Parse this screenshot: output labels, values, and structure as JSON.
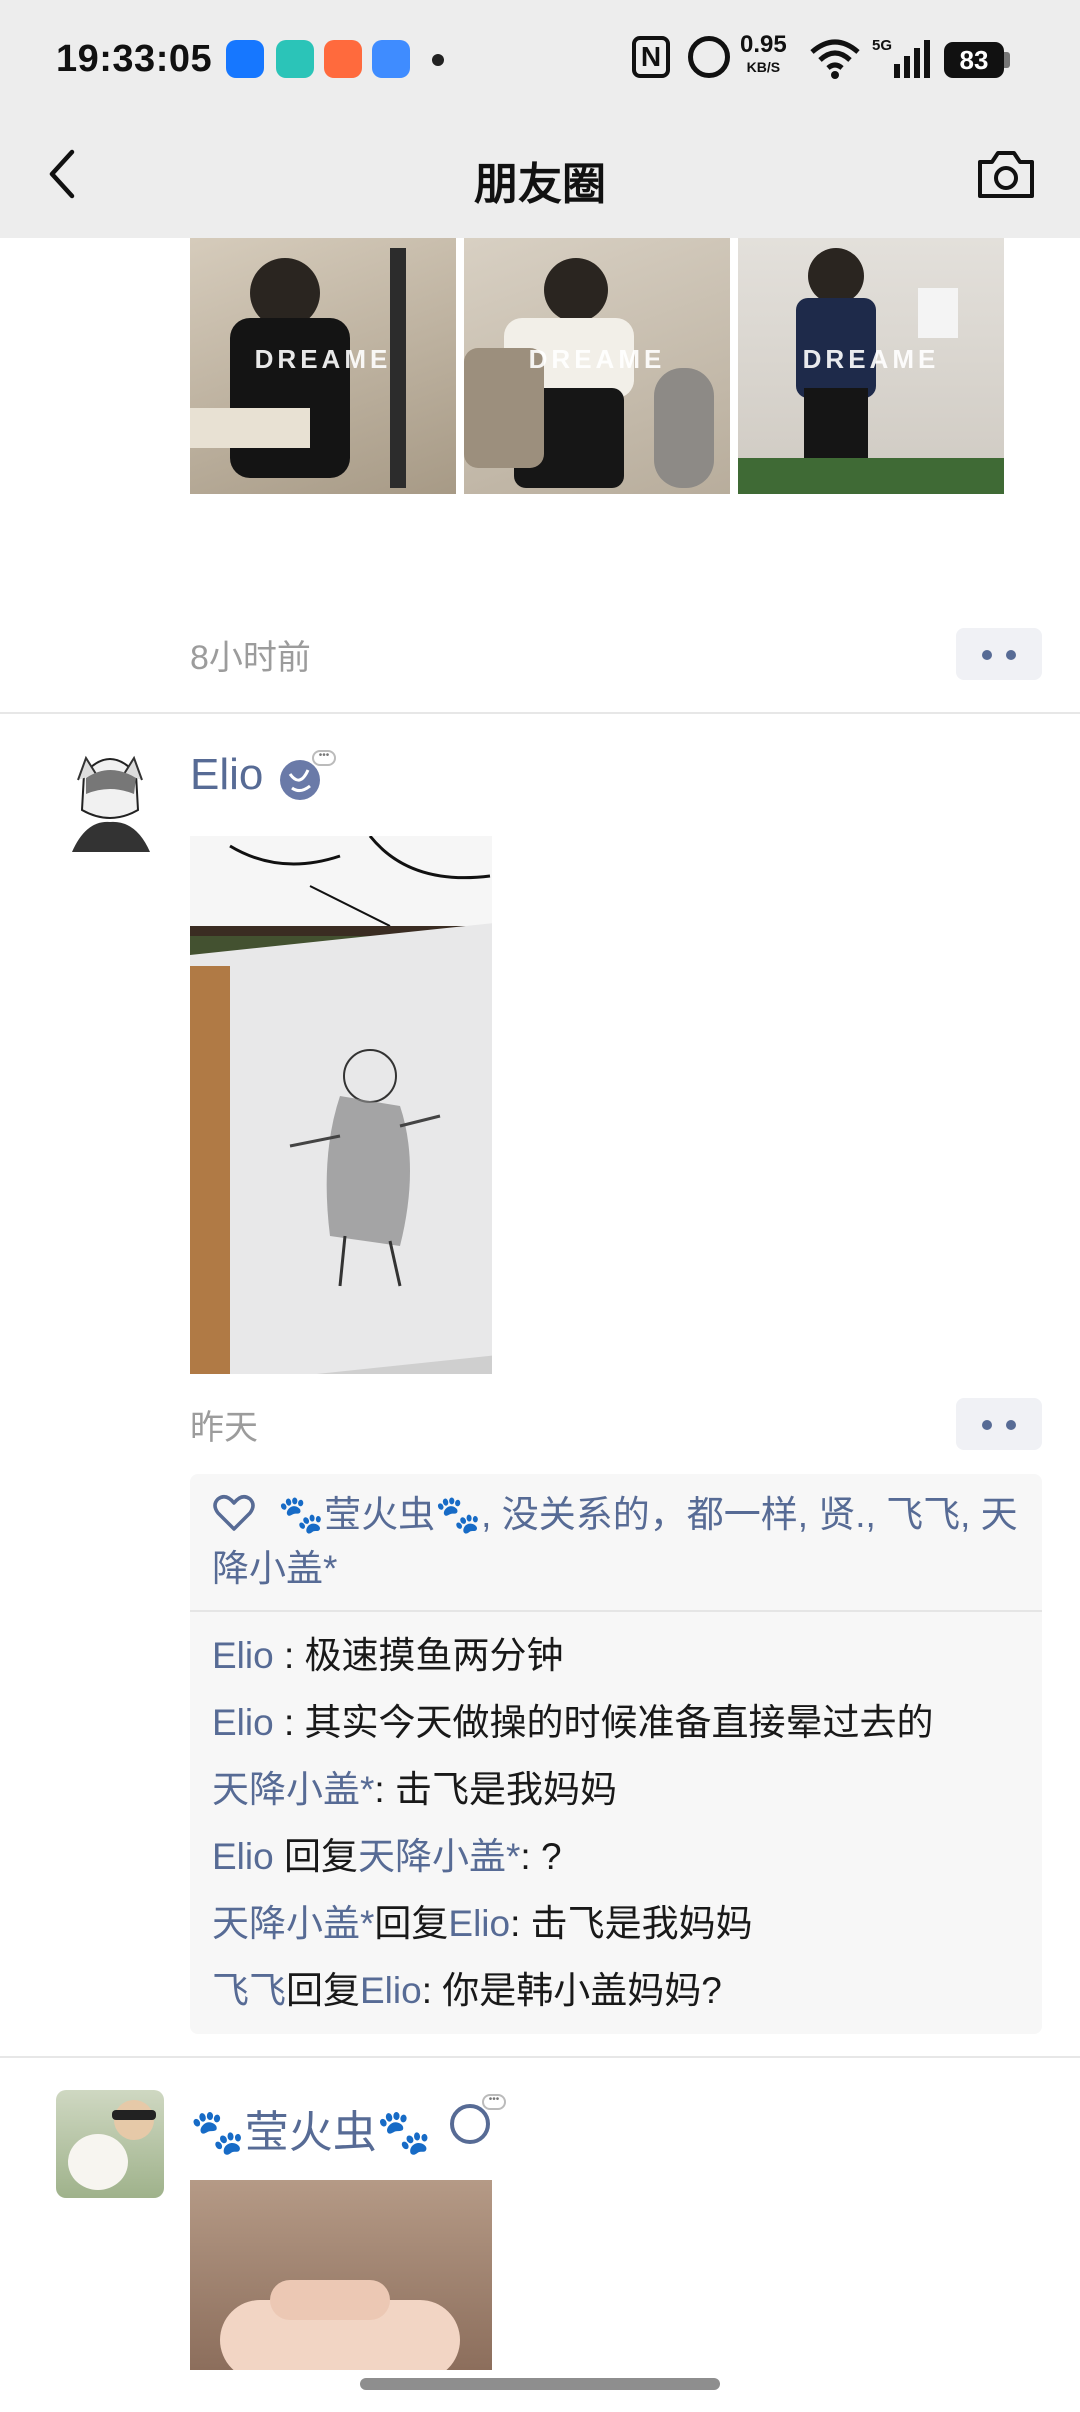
{
  "status_bar": {
    "time": "19:33:05",
    "net_speed_value": "0.95",
    "net_speed_unit": "KB/S",
    "network_type": "5G",
    "battery": "83",
    "icons": [
      "app-icon-1",
      "app-icon-2",
      "app-icon-3",
      "app-icon-4",
      "notification-dot",
      "nfc-icon",
      "alarm-icon",
      "wifi-icon",
      "signal-icon",
      "battery-icon"
    ]
  },
  "nav": {
    "title": "朋友圈",
    "back_icon": "back-arrow-icon",
    "camera_icon": "camera-icon"
  },
  "posts": [
    {
      "images_watermark": "DREAME",
      "time": "8小时前"
    },
    {
      "nickname": "Elio",
      "time": "昨天",
      "likes": "🐾莹火虫🐾, 没关系的，都一样, 贤., 飞飞, 天降小盖*",
      "comments": [
        {
          "from": "Elio",
          "reply_word": "",
          "to": "",
          "text": " : 极速摸鱼两分钟"
        },
        {
          "from": "Elio",
          "reply_word": "",
          "to": "",
          "text": " : 其实今天做操的时候准备直接晕过去的"
        },
        {
          "from": "天降小盖*",
          "reply_word": "",
          "to": "",
          "text": ": 击飞是我妈妈"
        },
        {
          "from": "Elio",
          "reply_word": " 回复",
          "to": "天降小盖*",
          "text": ": ?"
        },
        {
          "from": "天降小盖*",
          "reply_word": "回复",
          "to": "Elio",
          "text": ": 击飞是我妈妈"
        },
        {
          "from": "飞飞",
          "reply_word": "回复",
          "to": "Elio",
          "text": ": 你是韩小盖妈妈?"
        }
      ]
    },
    {
      "nickname": "🐾莹火虫🐾"
    }
  ],
  "colors": {
    "link": "#576b95",
    "nav_bg": "#ededed",
    "comment_bg": "#f7f7f7"
  }
}
